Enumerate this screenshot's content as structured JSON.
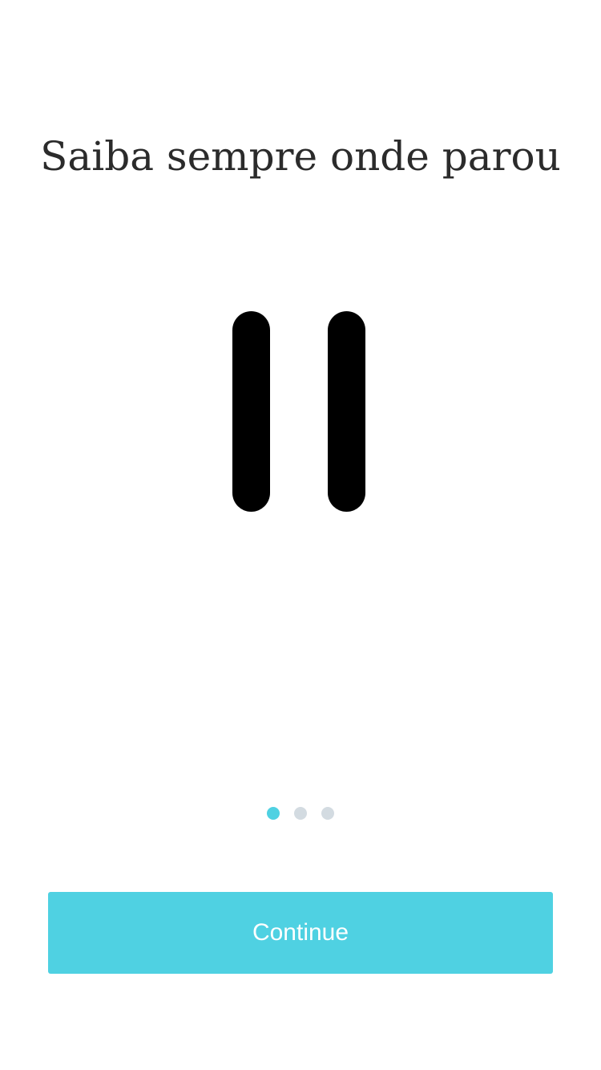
{
  "onboarding": {
    "title": "Saiba sempre onde parou",
    "illustration_icon": "pause-icon",
    "pager": {
      "total": 3,
      "current": 1,
      "active_color": "#4fd1e2",
      "inactive_color": "#d3dbe1"
    },
    "continue_label": "Continue",
    "accent_color": "#4fd1e2"
  }
}
